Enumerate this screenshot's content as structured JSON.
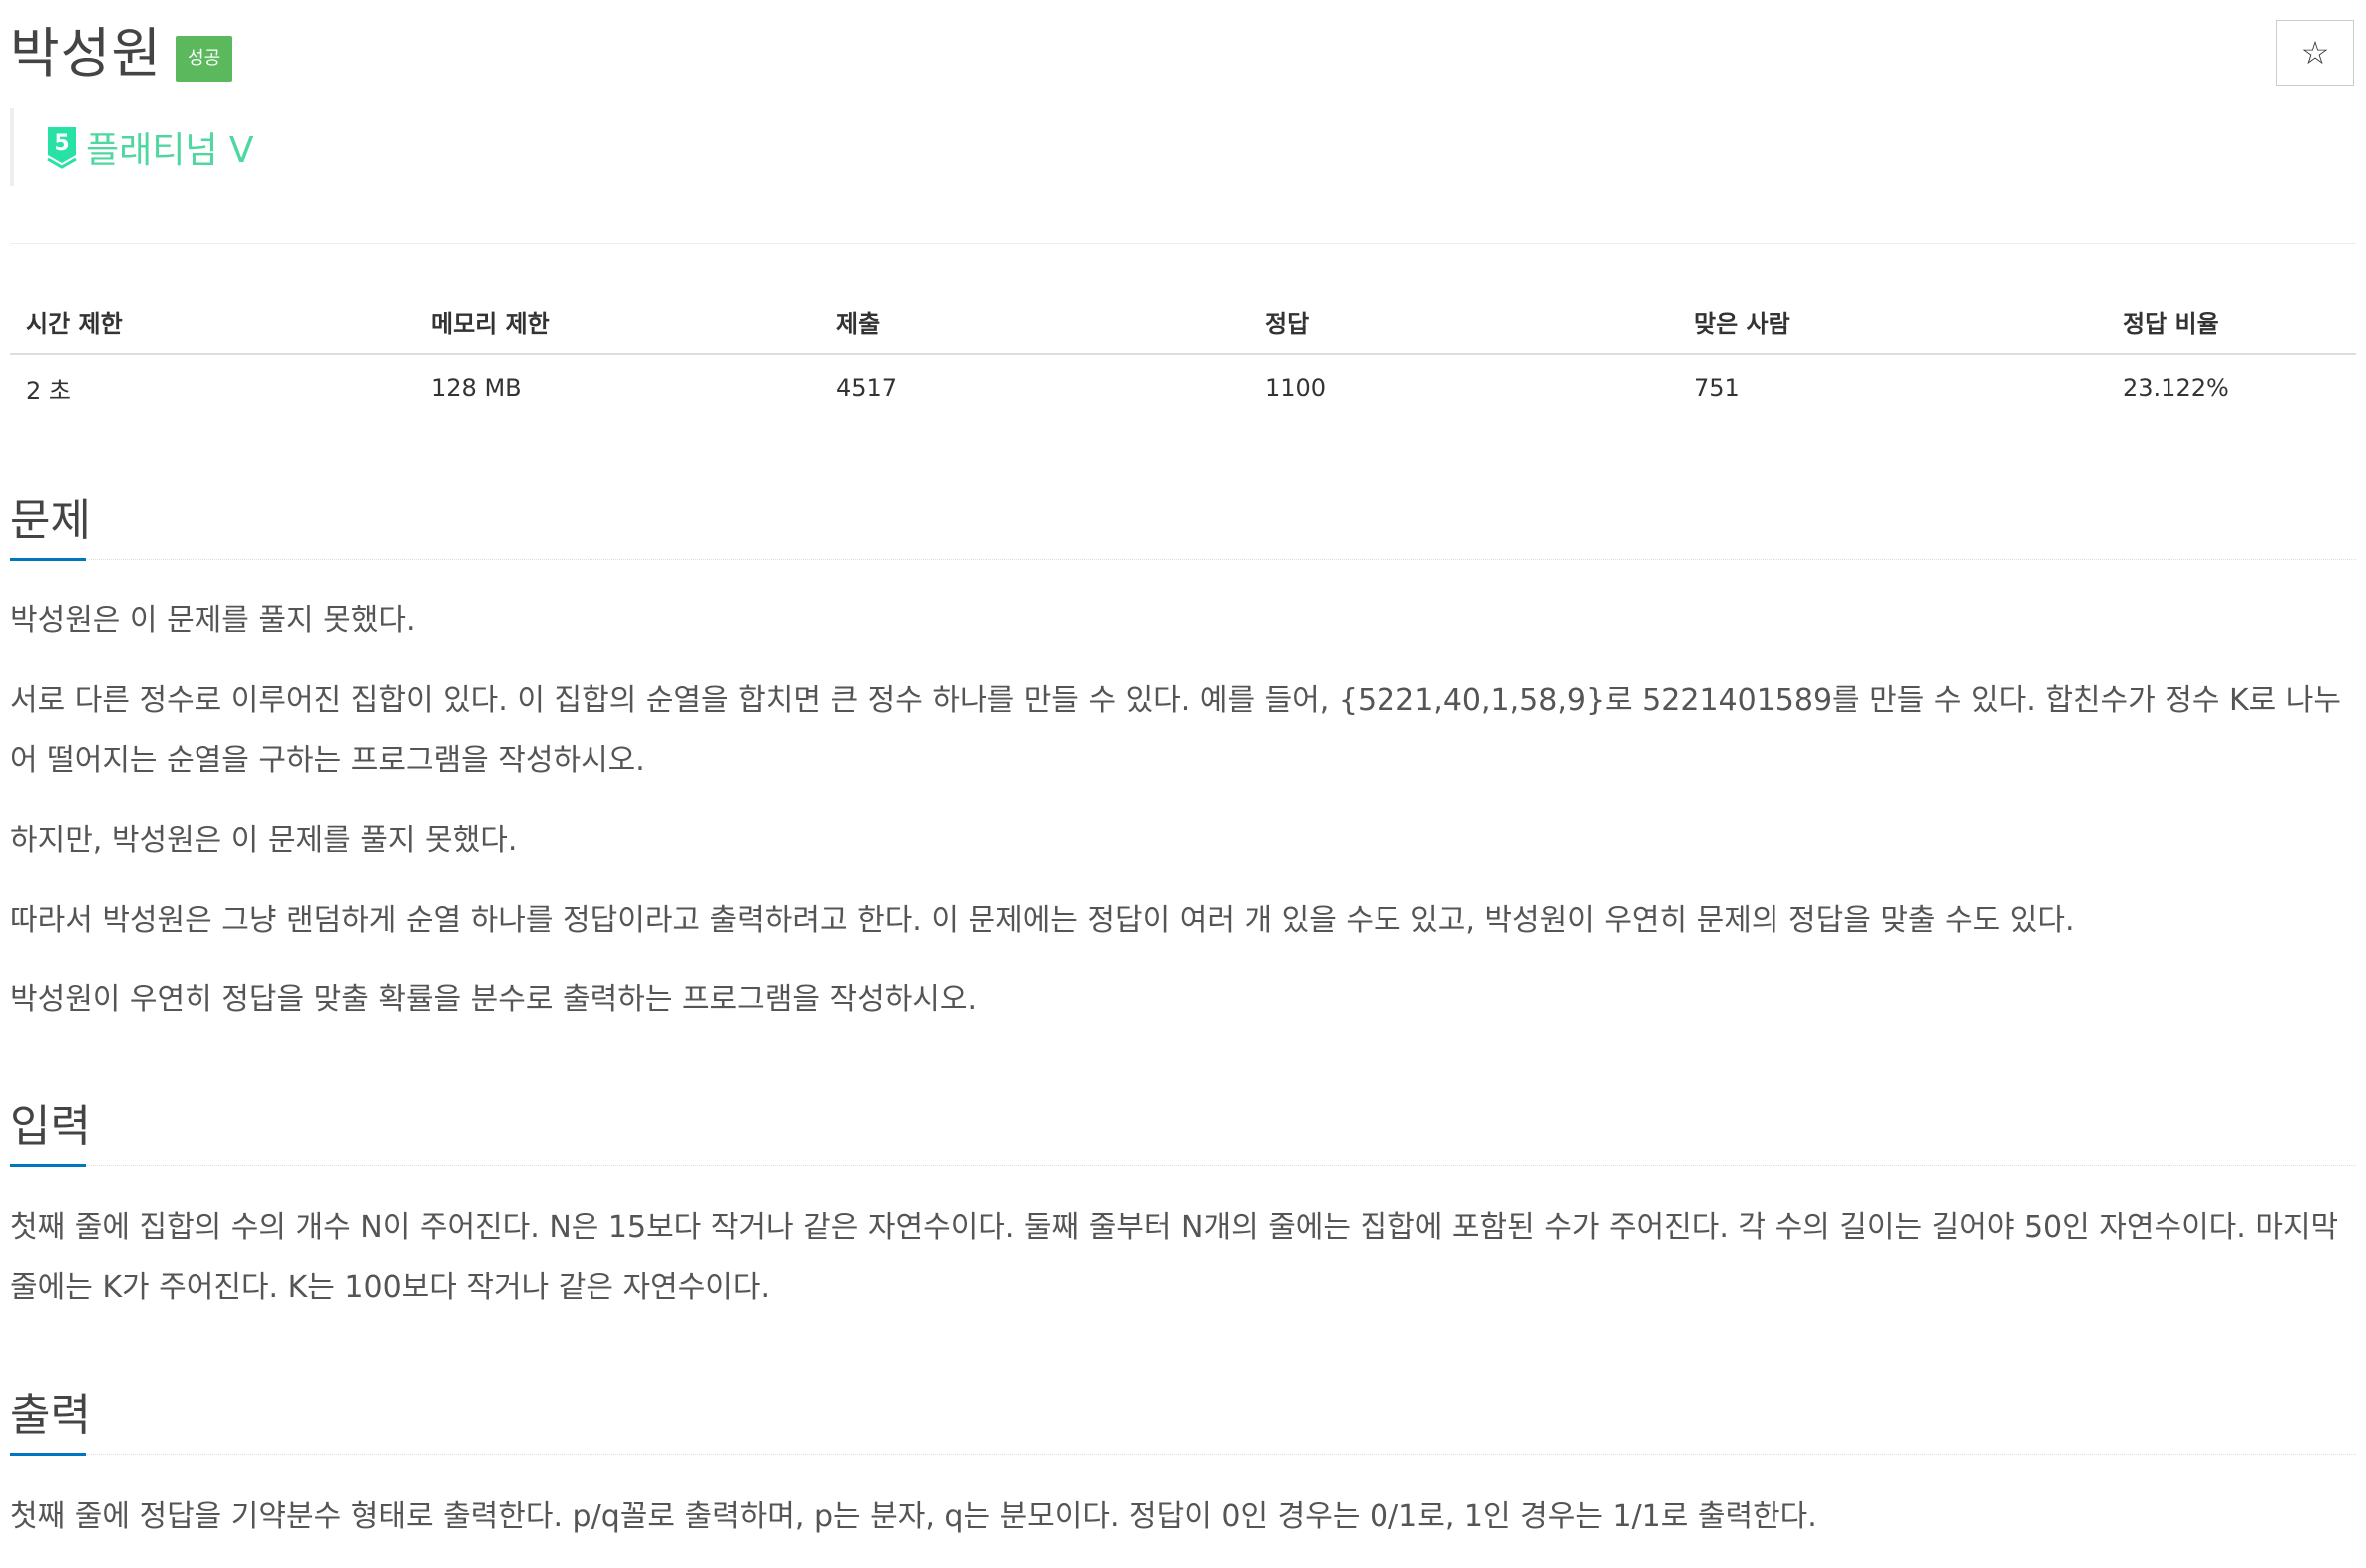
{
  "header": {
    "title": "박성원",
    "status_badge": "성공",
    "star_symbol": "☆",
    "tier_label": "플래티넘 V",
    "tier_number": "5",
    "tier_color": "#27e2a4"
  },
  "info_table": {
    "headers": [
      "시간 제한",
      "메모리 제한",
      "제출",
      "정답",
      "맞은 사람",
      "정답 비율"
    ],
    "values": [
      "2 초",
      "128 MB",
      "4517",
      "1100",
      "751",
      "23.122%"
    ]
  },
  "sections": {
    "problem": {
      "title": "문제",
      "paragraphs": [
        "박성원은 이 문제를 풀지 못했다.",
        "서로 다른 정수로 이루어진 집합이 있다. 이 집합의 순열을 합치면 큰 정수 하나를 만들 수 있다. 예를 들어, {5221,40,1,58,9}로 5221401589를 만들 수 있다. 합친수가 정수 K로 나누어 떨어지는 순열을 구하는 프로그램을 작성하시오.",
        "하지만, 박성원은 이 문제를 풀지 못했다.",
        "따라서 박성원은 그냥 랜덤하게 순열 하나를 정답이라고 출력하려고 한다. 이 문제에는 정답이 여러 개 있을 수도 있고, 박성원이 우연히 문제의 정답을 맞출 수도 있다.",
        "박성원이 우연히 정답을 맞출 확률을 분수로 출력하는 프로그램을 작성하시오."
      ]
    },
    "input": {
      "title": "입력",
      "paragraphs": [
        "첫째 줄에 집합의 수의 개수 N이 주어진다. N은 15보다 작거나 같은 자연수이다. 둘째 줄부터 N개의 줄에는 집합에 포함된 수가 주어진다. 각 수의 길이는 길어야 50인 자연수이다. 마지막 줄에는 K가 주어진다. K는 100보다 작거나 같은 자연수이다."
      ]
    },
    "output": {
      "title": "출력",
      "paragraphs": [
        "첫째 줄에 정답을 기약분수 형태로 출력한다. p/q꼴로 출력하며, p는 분자, q는 분모이다. 정답이 0인 경우는 0/1로, 1인 경우는 1/1로 출력한다."
      ]
    }
  },
  "colors": {
    "success_badge": "#5cb85c",
    "section_accent": "#0076c0",
    "tier_green": "#27e2a4"
  }
}
